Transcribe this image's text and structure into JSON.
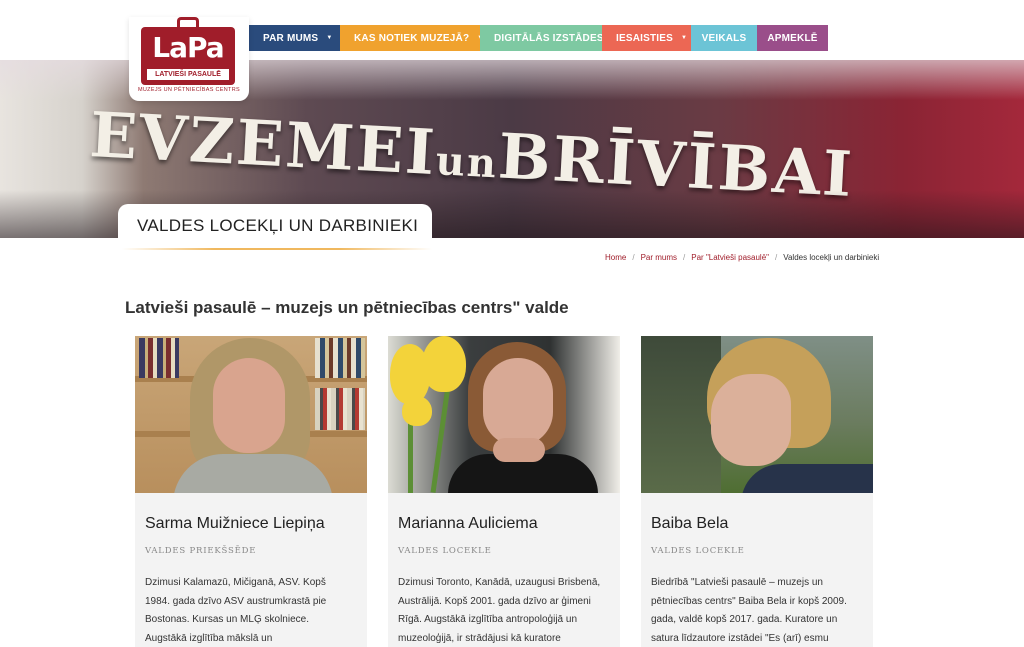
{
  "header": {
    "logo": {
      "text": "LaPa",
      "strip": "LATVIEŠI PASAULĒ",
      "subtitle": "MUZEJS UN PĒTNIECĪBAS CENTRS"
    },
    "nav": [
      {
        "label": "PAR MUMS",
        "has_dropdown": true,
        "color": "#2a4b7c"
      },
      {
        "label": "KAS NOTIEK MUZEJĀ?",
        "has_dropdown": true,
        "color": "#f0a22e"
      },
      {
        "label": "DIGITĀLĀS IZSTĀDES",
        "has_dropdown": false,
        "color": "#7ec9a2"
      },
      {
        "label": "IESAISTIES",
        "has_dropdown": true,
        "color": "#ec6754"
      },
      {
        "label": "VEIKALS",
        "has_dropdown": false,
        "color": "#6cc4d6"
      },
      {
        "label": "APMEKLĒ",
        "has_dropdown": false,
        "color": "#9a4e8a"
      }
    ]
  },
  "hero": {
    "sign_text_part1": "EVZEMEI",
    "sign_text_un": "un",
    "sign_text_part2": "BRĪVĪBAI",
    "title": "VALDES LOCEKĻI UN DARBINIEKI"
  },
  "breadcrumb": {
    "items": [
      "Home",
      "Par mums",
      "Par \"Latvieši pasaulē\""
    ],
    "current": "Valdes locekļi un darbinieki",
    "separator": "/"
  },
  "section_title": "Latvieši pasaulē – muzejs un pētniecības centrs\" valde",
  "members": [
    {
      "name": "Sarma Muižniece Liepiņa",
      "role": "VALDES PRIEKŠSĒDE",
      "bio_lines": [
        "Dzimusi Kalamazū, Mičiganā, ASV. Kopš",
        "1984. gada  dzīvo ASV austrumkrastā pie",
        "Bostonas. Kursas un MLĢ skolniece.",
        "Augstākā izglītība mākslā un"
      ]
    },
    {
      "name": "Marianna Auliciema",
      "role": "VALDES LOCEKLE",
      "bio_lines": [
        "Dzimusi Toronto, Kanādā, uzaugusi Brisbenā,",
        "Austrālijā. Kopš 2001. gada dzīvo ar ģimeni",
        "Rīgā. Augstākā izglītība antropoloģijā un",
        "muzeoloģijā, ir strādājusi kā kuratore"
      ]
    },
    {
      "name": "Baiba Bela",
      "role": "VALDES LOCEKLE",
      "bio_lines": [
        "Biedrībā \"Latvieši pasaulē – muzejs un",
        "pētniecības centrs\" Baiba Bela ir kopš 2009.",
        "gada, valdē kopš 2017. gada. Kuratore un",
        "satura līdzautore izstādei \"Es (arī) esmu"
      ]
    }
  ],
  "colors": {
    "brand_red": "#a01d2a",
    "accent_gold": "#f0b85e"
  }
}
